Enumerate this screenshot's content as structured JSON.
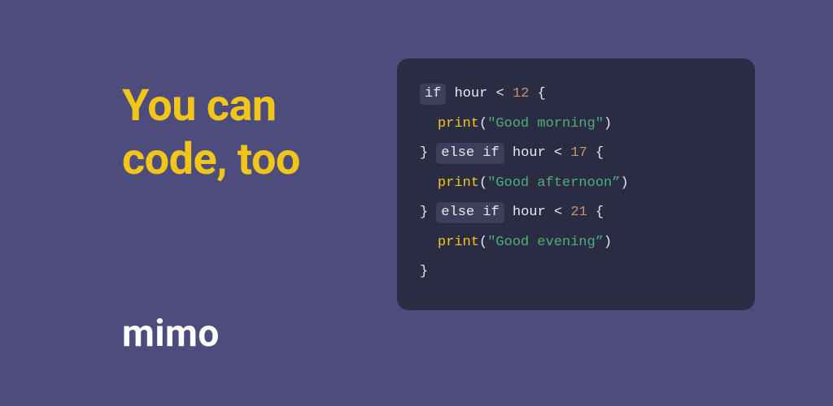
{
  "headline_line1": "You can",
  "headline_line2": "code, too",
  "brand": "mimo",
  "code": {
    "l1_kw": "if",
    "l1_rest_a": " hour < ",
    "l1_num": "12",
    "l1_rest_b": " {",
    "l2_fn": "print",
    "l2_paren_open": "(",
    "l2_str": "\"Good morning\"",
    "l2_paren_close": ")",
    "l3_brace": "} ",
    "l3_kw": "else if",
    "l3_rest_a": " hour < ",
    "l3_num": "17",
    "l3_rest_b": " {",
    "l4_fn": "print",
    "l4_paren_open": "(",
    "l4_str": "\"Good afternoon”",
    "l4_paren_close": ")",
    "l5_brace": "} ",
    "l5_kw": "else if",
    "l5_rest_a": " hour < ",
    "l5_num": "21",
    "l5_rest_b": " {",
    "l6_fn": "print",
    "l6_paren_open": "(",
    "l6_str": "\"Good evening”",
    "l6_paren_close": ")",
    "l7_brace": "}"
  }
}
